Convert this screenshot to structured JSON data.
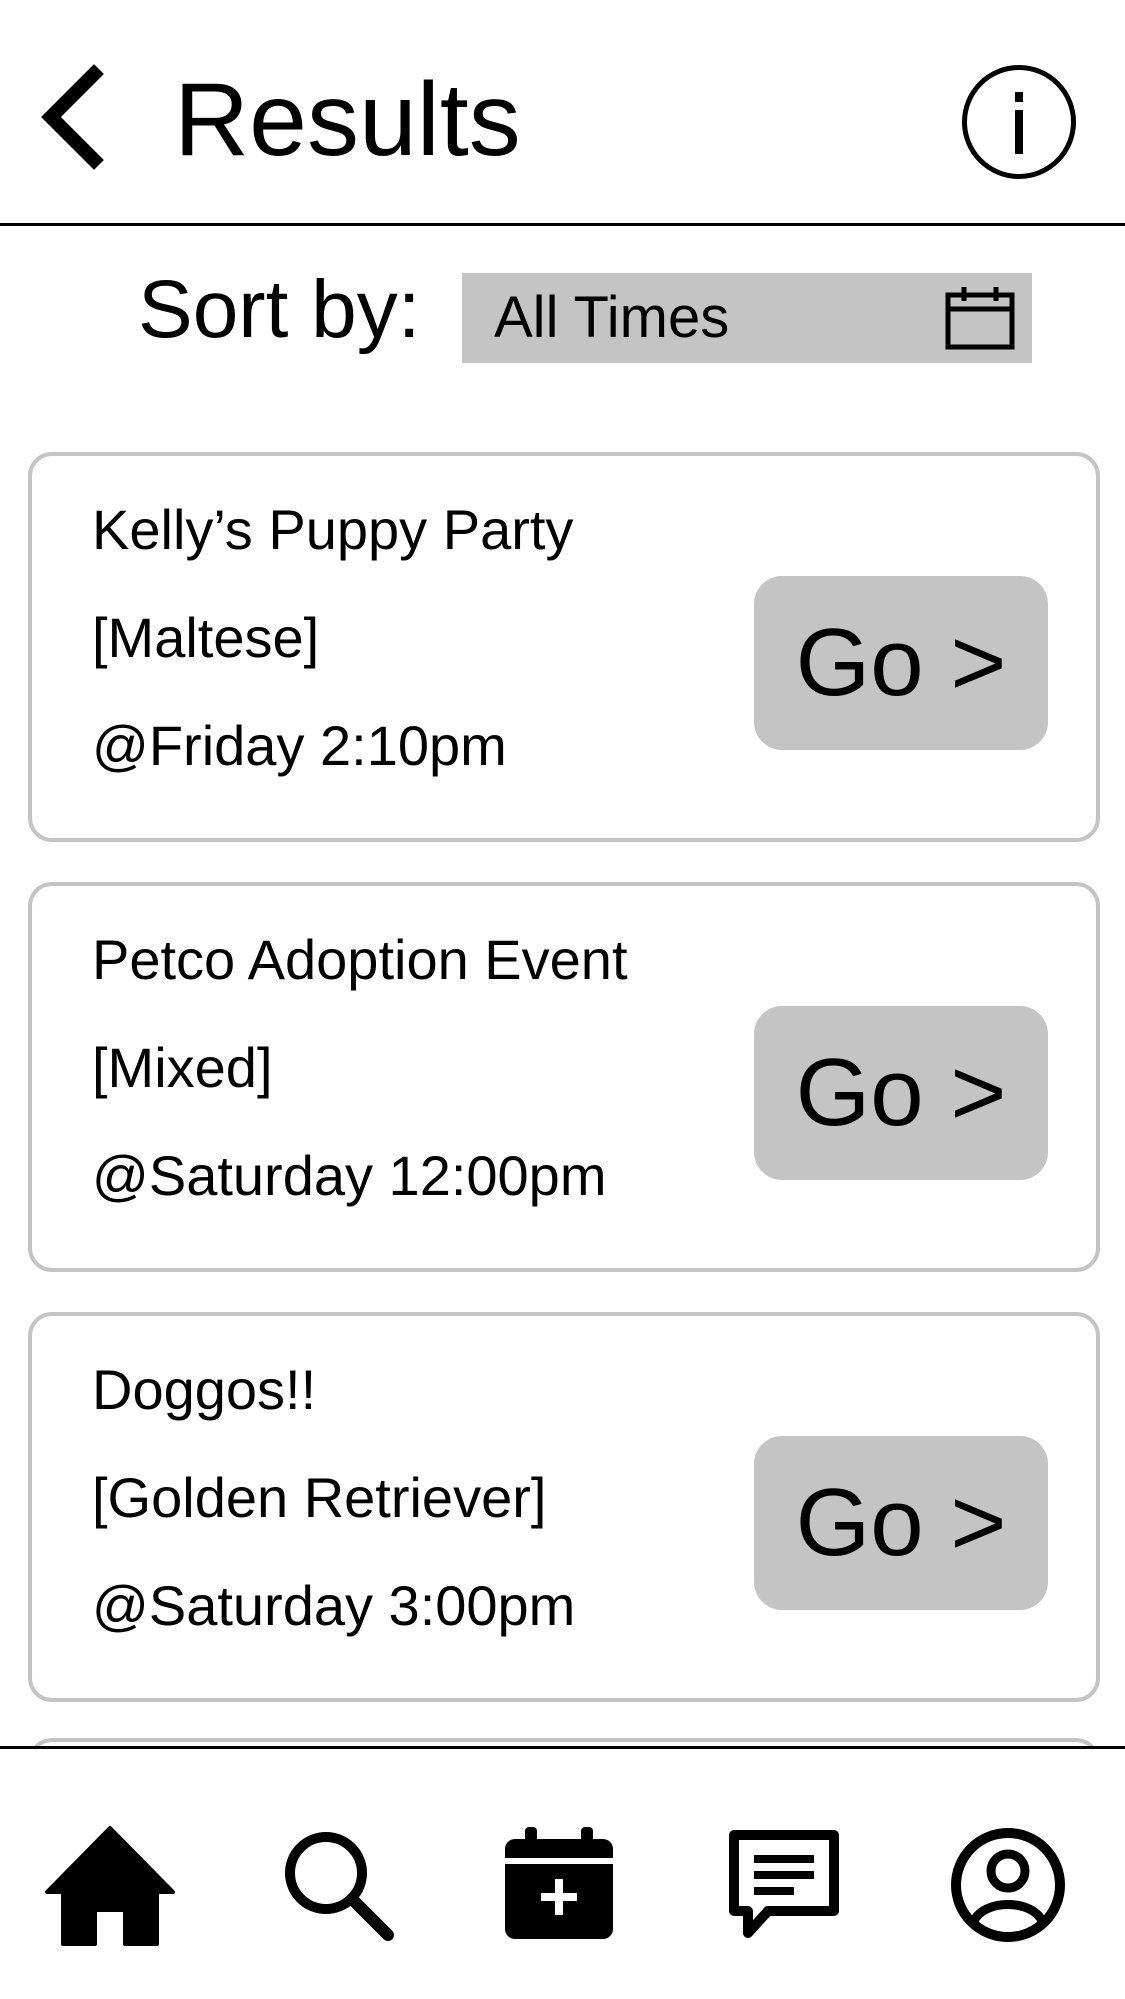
{
  "header": {
    "title": "Results",
    "back_icon": "chevron-left-icon",
    "info_icon": "info-icon"
  },
  "sort": {
    "label": "Sort by:",
    "value": "All Times",
    "icon": "calendar-icon"
  },
  "events": [
    {
      "name": "Kelly’s Puppy Party",
      "breed": "[Maltese]",
      "time": "@Friday 2:10pm",
      "action": "Go >"
    },
    {
      "name": "Petco Adoption Event",
      "breed": "[Mixed]",
      "time": "@Saturday 12:00pm",
      "action": "Go >"
    },
    {
      "name": "Doggos!!",
      "breed": "[Golden Retriever]",
      "time": "@Saturday 3:00pm",
      "action": "Go >"
    }
  ],
  "bottom_nav": {
    "items": [
      "home-icon",
      "search-icon",
      "calendar-add-icon",
      "chat-icon",
      "profile-icon"
    ],
    "active": "home-icon"
  }
}
